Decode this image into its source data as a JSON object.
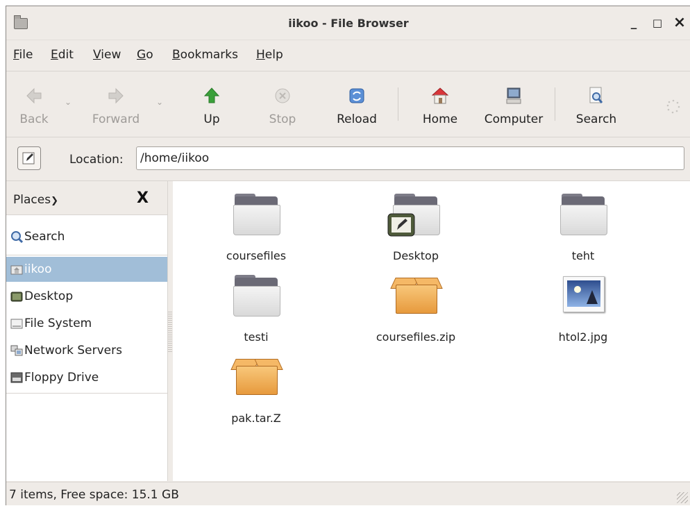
{
  "window": {
    "title": "iikoo - File Browser",
    "controls": {
      "minimize": "_",
      "maximize": "□",
      "close": "×"
    }
  },
  "menubar": {
    "items": [
      {
        "label": "File",
        "mnemonic": "F"
      },
      {
        "label": "Edit",
        "mnemonic": "E"
      },
      {
        "label": "View",
        "mnemonic": "V"
      },
      {
        "label": "Go",
        "mnemonic": "G"
      },
      {
        "label": "Bookmarks",
        "mnemonic": "B"
      },
      {
        "label": "Help",
        "mnemonic": "H"
      }
    ]
  },
  "toolbar": {
    "back": {
      "label": "Back",
      "enabled": false
    },
    "forward": {
      "label": "Forward",
      "enabled": false
    },
    "up": {
      "label": "Up",
      "enabled": true
    },
    "stop": {
      "label": "Stop",
      "enabled": false
    },
    "reload": {
      "label": "Reload",
      "enabled": true
    },
    "home": {
      "label": "Home",
      "enabled": true
    },
    "computer": {
      "label": "Computer",
      "enabled": true
    },
    "search": {
      "label": "Search",
      "enabled": true
    }
  },
  "location": {
    "label": "Location:",
    "value": "/home/iikoo"
  },
  "sidebar": {
    "header": "Places",
    "close_symbol": "X",
    "items": [
      {
        "label": "Search",
        "icon": "search-icon",
        "selected": false
      },
      {
        "label": "iikoo",
        "icon": "home-folder-icon",
        "selected": true
      },
      {
        "label": "Desktop",
        "icon": "desktop-icon",
        "selected": false
      },
      {
        "label": "File System",
        "icon": "drive-icon",
        "selected": false
      },
      {
        "label": "Network Servers",
        "icon": "network-icon",
        "selected": false
      },
      {
        "label": "Floppy Drive",
        "icon": "floppy-icon",
        "selected": false
      }
    ]
  },
  "files": [
    {
      "name": "coursefiles",
      "type": "folder"
    },
    {
      "name": "Desktop",
      "type": "desktop-folder"
    },
    {
      "name": "teht",
      "type": "folder"
    },
    {
      "name": "testi",
      "type": "folder"
    },
    {
      "name": "coursefiles.zip",
      "type": "archive"
    },
    {
      "name": "htol2.jpg",
      "type": "image"
    },
    {
      "name": "pak.tar.Z",
      "type": "archive"
    }
  ],
  "status": {
    "text": "7 items, Free space: 15.1 GB"
  },
  "colors": {
    "window_bg": "#efebe7",
    "selection": "#a1bed8",
    "up_arrow": "#3aa03a",
    "home_roof": "#d9363a"
  }
}
